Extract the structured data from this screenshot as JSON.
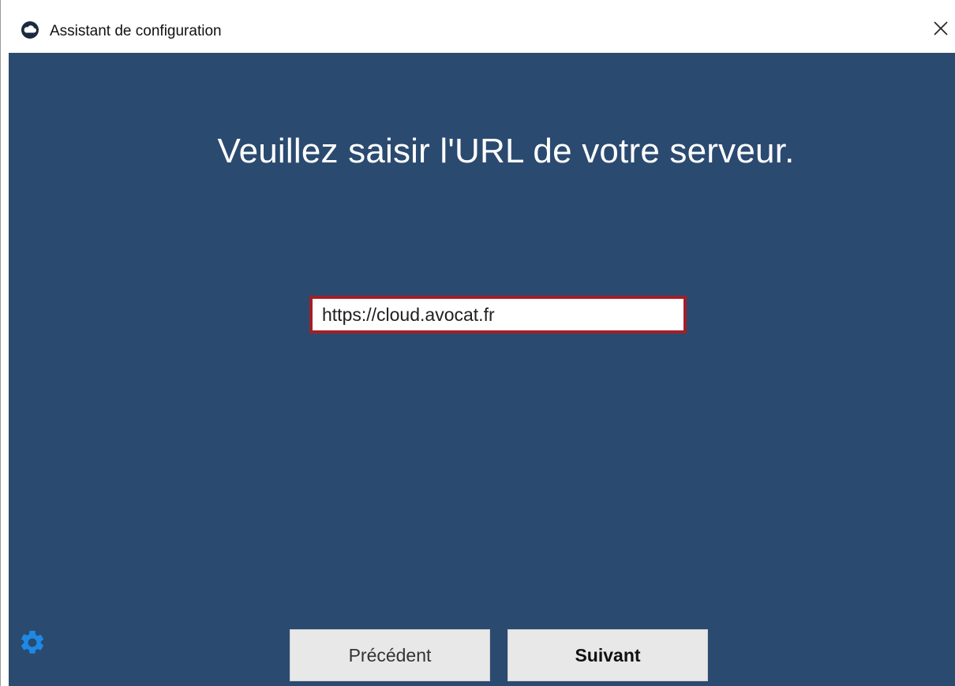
{
  "window": {
    "title": "Assistant de configuration"
  },
  "icons": {
    "app": "cloud-icon",
    "close": "close-icon",
    "settings": "gear-icon"
  },
  "main": {
    "heading": "Veuillez saisir l'URL de votre serveur.",
    "url_input_value": "https://cloud.avocat.fr"
  },
  "buttons": {
    "previous": "Précédent",
    "next": "Suivant"
  },
  "colors": {
    "background": "#2b4a70",
    "input_border": "#a11f28",
    "gear": "#1e88e5"
  }
}
